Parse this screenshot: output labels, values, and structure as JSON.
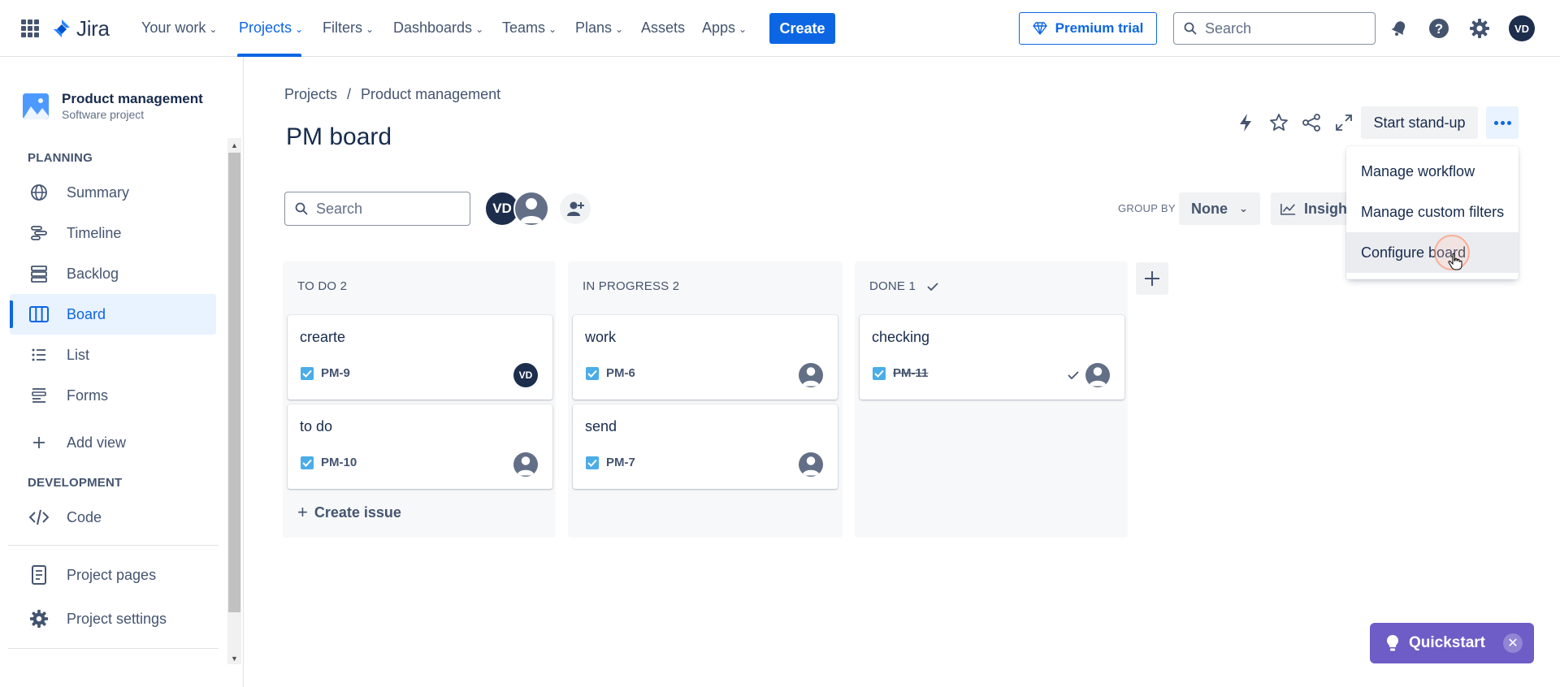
{
  "topnav": {
    "app_name": "Jira",
    "items": [
      "Your work",
      "Projects",
      "Filters",
      "Dashboards",
      "Teams",
      "Plans",
      "Assets",
      "Apps"
    ],
    "create_label": "Create",
    "premium_label": "Premium trial",
    "search_placeholder": "Search",
    "user_initials": "VD"
  },
  "sidebar": {
    "project_name": "Product management",
    "project_type": "Software project",
    "planning_heading": "PLANNING",
    "planning_items": [
      "Summary",
      "Timeline",
      "Backlog",
      "Board",
      "List",
      "Forms"
    ],
    "add_view_label": "Add view",
    "development_heading": "DEVELOPMENT",
    "code_label": "Code",
    "project_pages_label": "Project pages",
    "project_settings_label": "Project settings"
  },
  "main": {
    "breadcrumb": [
      "Projects",
      "Product management"
    ],
    "breadcrumb_sep": "/",
    "title": "PM board",
    "standup_label": "Start stand-up",
    "search_placeholder": "Search",
    "group_by_label": "GROUP BY",
    "group_by_value": "None",
    "insights_label": "Insights"
  },
  "columns": [
    {
      "title": "TO DO 2",
      "cards": [
        {
          "title": "crearte",
          "key": "PM-9",
          "assignee": "VD"
        },
        {
          "title": "to do",
          "key": "PM-10",
          "assignee": ""
        }
      ],
      "create_issue_label": "Create issue"
    },
    {
      "title": "IN PROGRESS 2",
      "cards": [
        {
          "title": "work",
          "key": "PM-6",
          "assignee": ""
        },
        {
          "title": "send",
          "key": "PM-7",
          "assignee": ""
        }
      ]
    },
    {
      "title": "DONE 1",
      "cards": [
        {
          "title": "checking",
          "key": "PM-11",
          "assignee": "",
          "done": true
        }
      ]
    }
  ],
  "more_menu": {
    "items": [
      "Manage workflow",
      "Manage custom filters",
      "Configure board"
    ],
    "hovered": "Configure board"
  },
  "quickstart_label": "Quickstart",
  "colors": {
    "brand_blue": "#0c66e4",
    "quickstart_purple": "#6e5dc6",
    "avatar_dark": "#1d2d4c"
  }
}
